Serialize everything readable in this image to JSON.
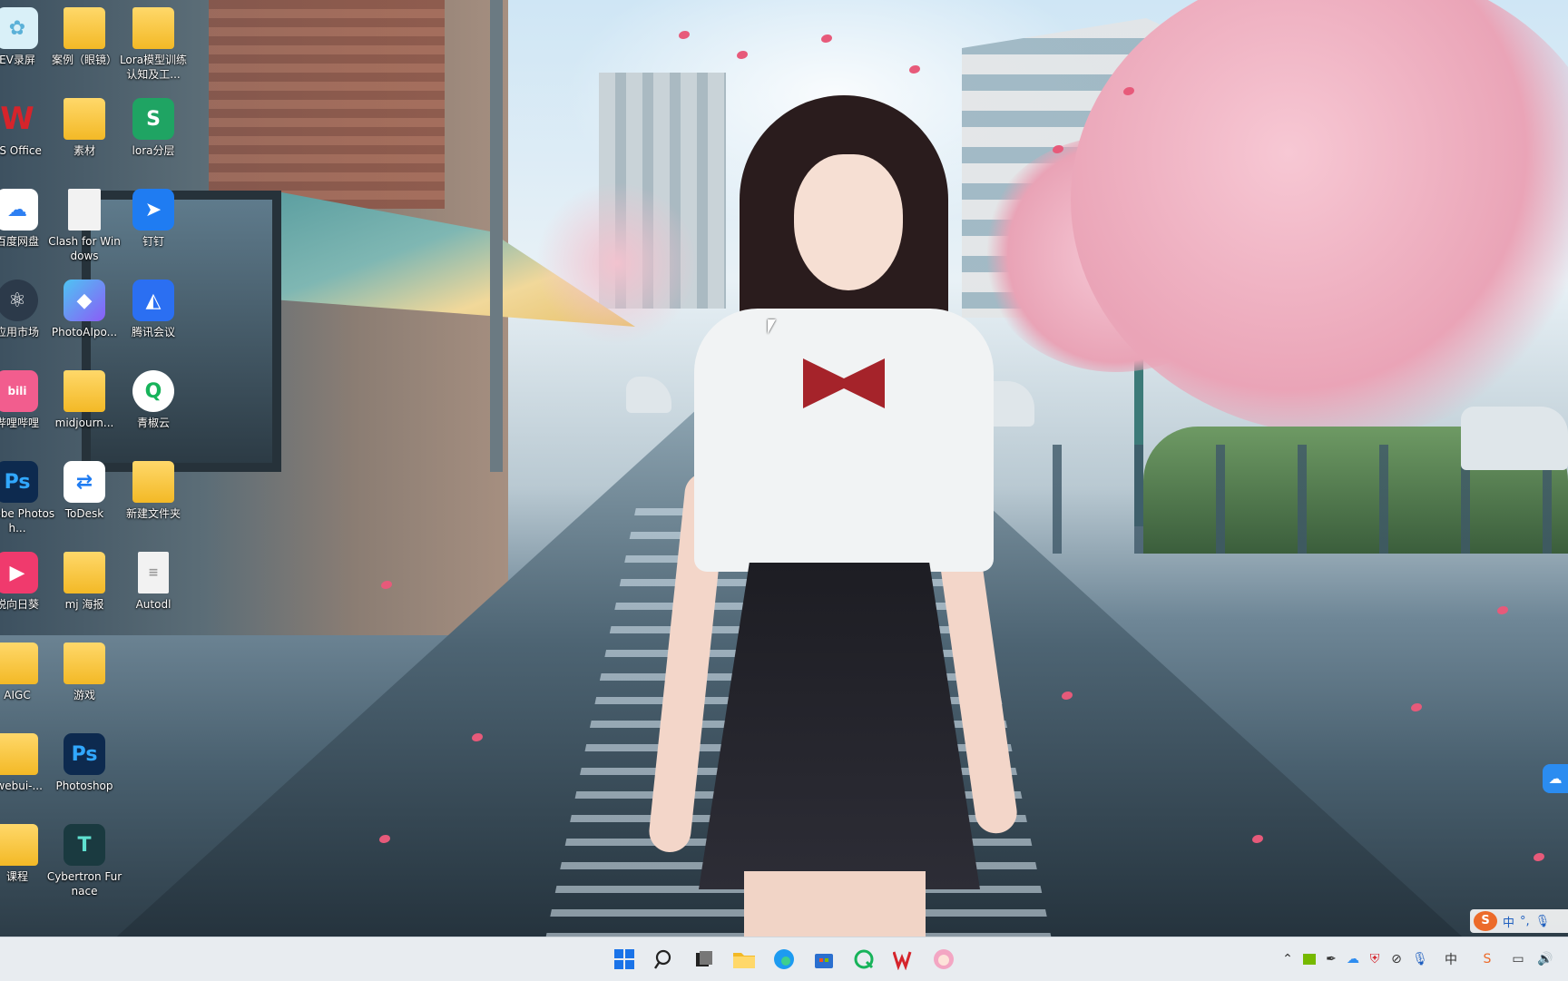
{
  "desktop": {
    "icons": [
      {
        "label": "EV录屏",
        "icon": "ev-recorder-icon",
        "color": "#d9f0f8"
      },
      {
        "label": "案例（眼镜）",
        "icon": "folder-icon"
      },
      {
        "label": "Lora模型训练认知及工...",
        "icon": "folder-icon"
      },
      {
        "label": "PS Office",
        "icon": "wps-office-icon",
        "color": "#d5242b"
      },
      {
        "label": "素材",
        "icon": "folder-icon"
      },
      {
        "label": "lora分层",
        "icon": "spreadsheet-icon",
        "color": "#1fa463"
      },
      {
        "label": "百度网盘",
        "icon": "baidu-netdisk-icon",
        "color": "#2d7ff2"
      },
      {
        "label": "Clash for Windows",
        "icon": "file-icon",
        "color": "#f2f2f2"
      },
      {
        "label": "钉钉",
        "icon": "dingtalk-icon",
        "color": "#1f7cf2"
      },
      {
        "label": "应用市场",
        "icon": "app-market-icon",
        "color": "#2c3a4a"
      },
      {
        "label": "PhotoAIpo...",
        "icon": "photoai-icon",
        "color": "#6b5cf0"
      },
      {
        "label": "腾讯会议",
        "icon": "tencent-meeting-icon",
        "color": "#2b6ff2"
      },
      {
        "label": "哔哩哔哩",
        "icon": "bilibili-icon",
        "color": "#f25d8e"
      },
      {
        "label": "midjourn...",
        "icon": "folder-icon"
      },
      {
        "label": "青椒云",
        "icon": "qingjiao-cloud-icon",
        "color": "#17b35a"
      },
      {
        "label": "Adobe Photosh...",
        "icon": "photoshop-icon",
        "color": "#0d2a4f"
      },
      {
        "label": "ToDesk",
        "icon": "todesk-icon",
        "color": "#ffffff"
      },
      {
        "label": "新建文件夹",
        "icon": "folder-icon"
      },
      {
        "label": "锐向日葵",
        "icon": "sunflower-icon",
        "color": "#f03a6d"
      },
      {
        "label": "mj 海报",
        "icon": "folder-icon"
      },
      {
        "label": "Autodl",
        "icon": "document-icon",
        "color": "#f2f2f2"
      },
      {
        "label": "AIGC",
        "icon": "folder-icon"
      },
      {
        "label": "游戏",
        "icon": "folder-icon"
      },
      {
        "label": "-webui-...",
        "icon": "folder-icon"
      },
      {
        "label": "Photoshop",
        "icon": "photoshop-icon",
        "color": "#0d2a4f"
      },
      {
        "label": "课程",
        "icon": "folder-icon"
      },
      {
        "label": "Cybertron Furnace",
        "icon": "cybertron-furnace-icon",
        "color": "#1a3a40"
      }
    ]
  },
  "ime": {
    "mode": "中",
    "punct": "°,",
    "logo": "S"
  },
  "taskbar": {
    "apps": [
      {
        "name": "start",
        "icon": "windows-start-icon",
        "color": "#1a73e8"
      },
      {
        "name": "search",
        "icon": "search-icon",
        "color": "#333333"
      },
      {
        "name": "task-view",
        "icon": "task-view-icon",
        "color": "#333333"
      },
      {
        "name": "file-explorer",
        "icon": "folder-icon",
        "color": "#f3b926"
      },
      {
        "name": "edge",
        "icon": "edge-browser-icon",
        "color": "#1d9bf0"
      },
      {
        "name": "store",
        "icon": "microsoft-store-icon",
        "color": "#2a6fcf"
      },
      {
        "name": "qingjiao",
        "icon": "qingjiao-cloud-icon",
        "color": "#17b35a"
      },
      {
        "name": "wps",
        "icon": "wps-office-icon",
        "color": "#d5242b"
      },
      {
        "name": "avatar-app",
        "icon": "anime-avatar-icon",
        "color": "#f3a6c3"
      }
    ],
    "tray": [
      "chevron-up-icon",
      "nvidia-icon",
      "feather-icon",
      "onedrive-icon",
      "security-icon",
      "eye-off-icon",
      "microphone-icon",
      "ime-icon",
      "sogou-icon",
      "network-icon",
      "volume-icon"
    ]
  }
}
